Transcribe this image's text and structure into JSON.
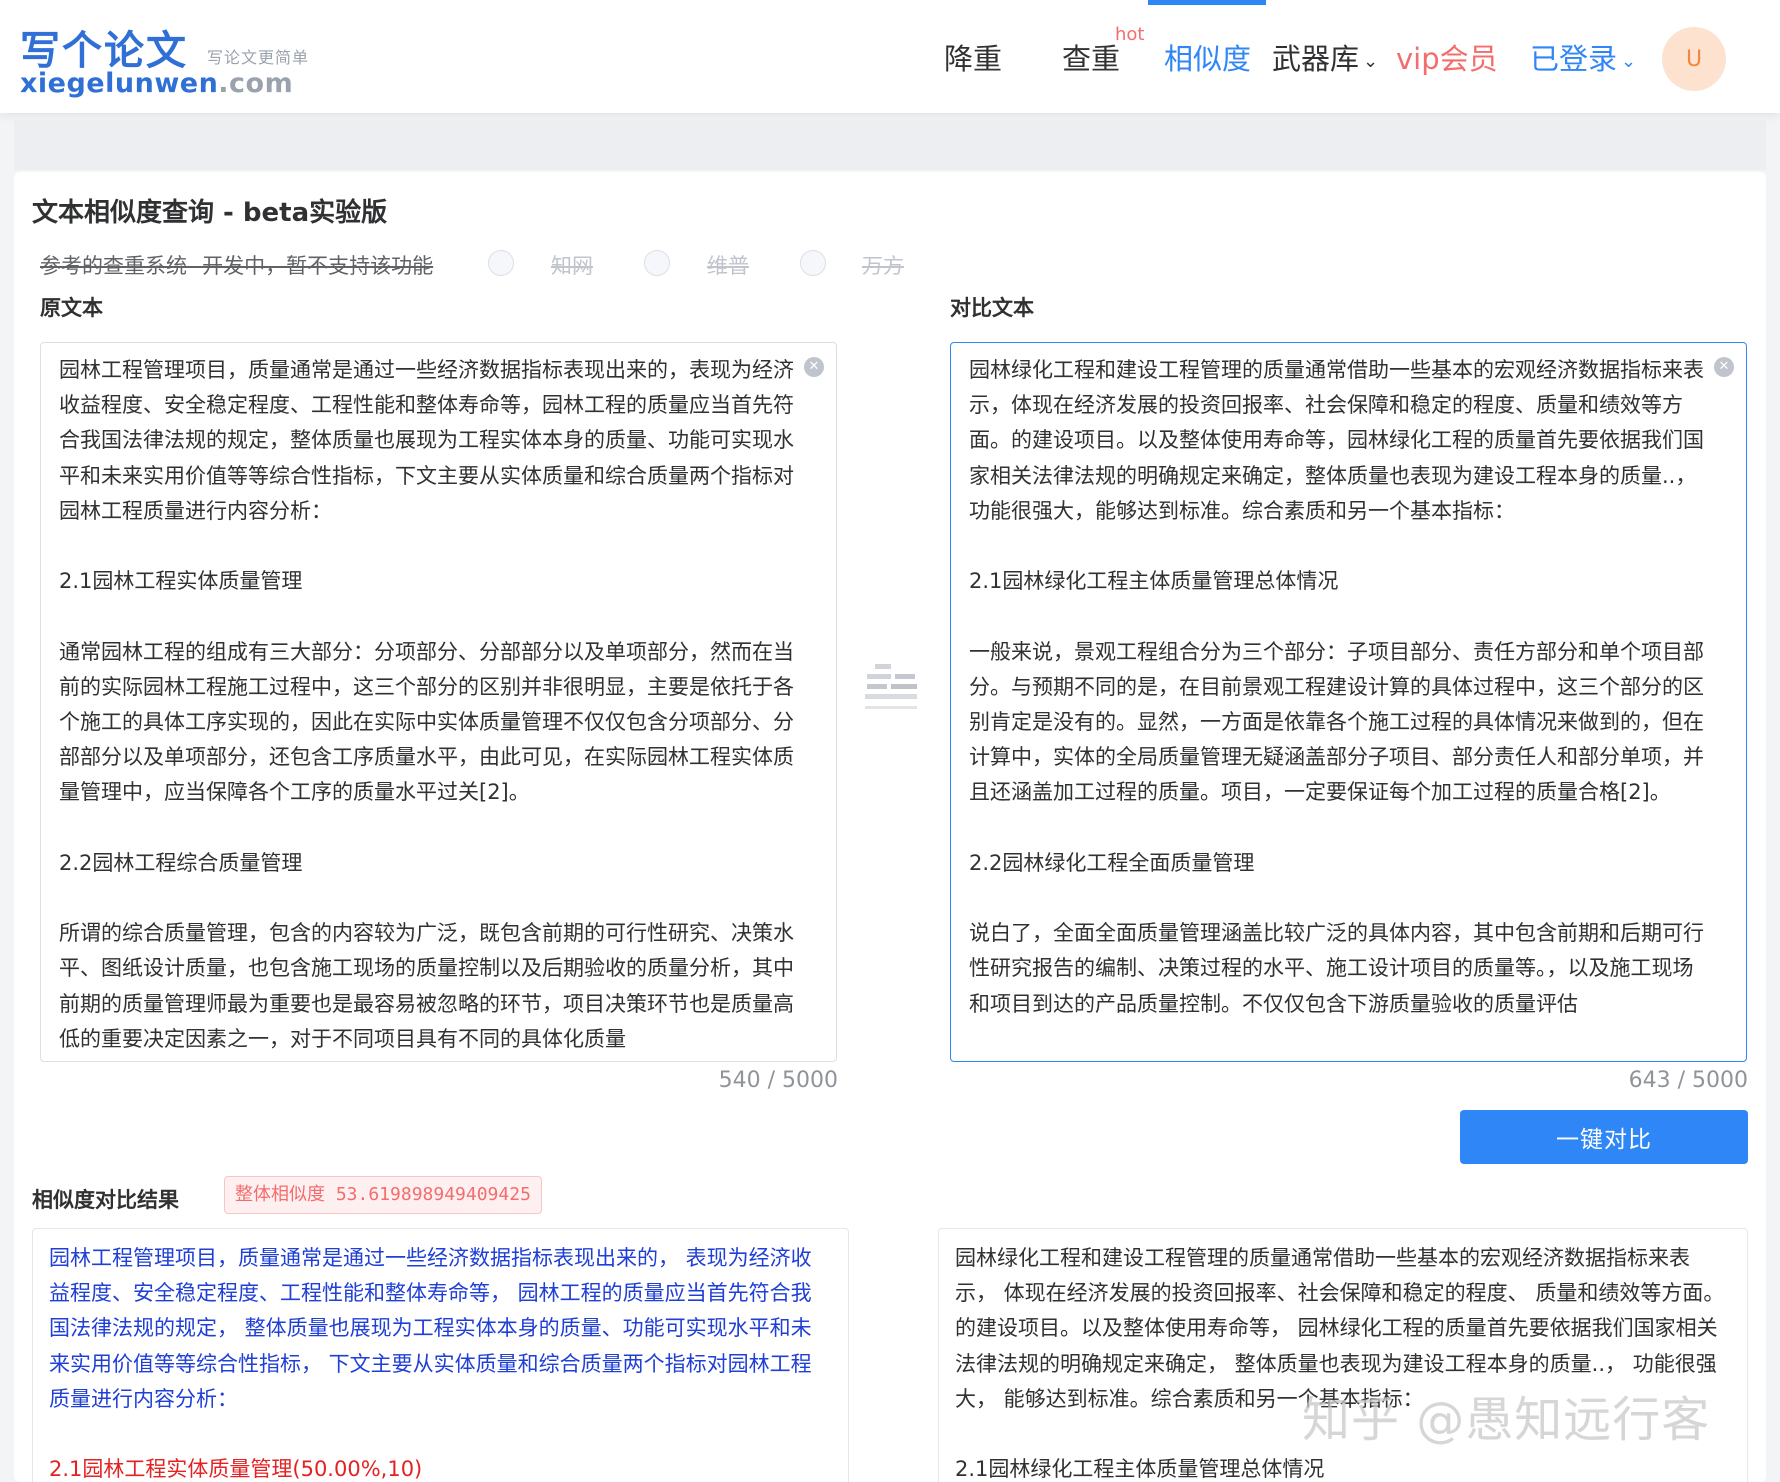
{
  "header": {
    "logo_main": "写个论文",
    "logo_sub": "写论文更简单",
    "logo_url": "xiegelunwen",
    "logo_url_suffix": ".com",
    "nav": {
      "reduce": "降重",
      "check": "查重",
      "hot": "hot",
      "similarity": "相似度",
      "arsenal": "武器库",
      "vip": "vip会员",
      "login": "已登录"
    },
    "avatar_letter": "U",
    "active_tab": "相似度"
  },
  "page": {
    "title": "文本相似度查询 - beta实验版",
    "ref_systems_label": "参考的查重系统--开发中，暂不支持该功能",
    "ref_systems": [
      "知网",
      "维普",
      "万方"
    ]
  },
  "original": {
    "label": "原文本",
    "text": "园林工程管理项目，质量通常是通过一些经济数据指标表现出来的，表现为经济收益程度、安全稳定程度、工程性能和整体寿命等，园林工程的质量应当首先符合我国法律法规的规定，整体质量也展现为工程实体本身的质量、功能可实现水平和未来实用价值等等综合性指标，下文主要从实体质量和综合质量两个指标对园林工程质量进行内容分析：\n\n2.1园林工程实体质量管理\n\n通常园林工程的组成有三大部分：分项部分、分部部分以及单项部分，然而在当前的实际园林工程施工过程中，这三个部分的区别并非很明显，主要是依托于各个施工的具体工序实现的，因此在实际中实体质量管理不仅仅包含分项部分、分部部分以及单项部分，还包含工序质量水平，由此可见，在实际园林工程实体质量管理中，应当保障各个工序的质量水平过关[2]。\n\n2.2园林工程综合质量管理\n\n所谓的综合质量管理，包含的内容较为广泛，既包含前期的可行性研究、决策水平、图纸设计质量，也包含施工现场的质量控制以及后期验收的质量分析，其中前期的质量管理师最为重要也是最容易被忽略的环节，项目决策环节也是质量高低的重要决定因素之一，对于不同项目具有不同的具体化质量",
    "counter": "540 / 5000"
  },
  "compare": {
    "label": "对比文本",
    "text": "园林绿化工程和建设工程管理的质量通常借助一些基本的宏观经济数据指标来表示，体现在经济发展的投资回报率、社会保障和稳定的程度、质量和绩效等方面。的建设项目。以及整体使用寿命等，园林绿化工程的质量首先要依据我们国家相关法律法规的明确规定来确定，整体质量也表现为建设工程本身的质量..，功能很强大，能够达到标准。综合素质和另一个基本指标：\n\n2.1园林绿化工程主体质量管理总体情况\n\n一般来说，景观工程组合分为三个部分：子项目部分、责任方部分和单个项目部分。与预期不同的是，在目前景观工程建设计算的具体过程中，这三个部分的区别肯定是没有的。显然，一方面是依靠各个施工过程的具体情况来做到的，但在计算中，实体的全局质量管理无疑涵盖部分子项目、部分责任人和部分单项，并且还涵盖加工过程的质量。项目，一定要保证每个加工过程的质量合格[2]。\n\n2.2园林绿化工程全面质量管理\n\n说白了，全面全面质量管理涵盖比较广泛的具体内容，其中包含前期和后期可行性研究报告的编制、决策过程的水平、施工设计项目的质量等。，以及施工现场和项目到达的产品质量控制。不仅仅包含下游质量验收的质量评估",
    "counter": "643 / 5000"
  },
  "action": {
    "compare_button": "一键对比"
  },
  "result": {
    "label": "相似度对比结果",
    "similarity_tag": "整体相似度 53.619898949409425",
    "similarity_value": 53.619898949409425,
    "left_blue": "园林工程管理项目，质量通常是通过一些经济数据指标表现出来的， 表现为经济收益程度、安全稳定程度、工程性能和整体寿命等， 园林工程的质量应当首先符合我国法律法规的规定， 整体质量也展现为工程实体本身的质量、功能可实现水平和未来实用价值等等综合性指标， 下文主要从实体质量和综合质量两个指标对园林工程质量进行内容分析：\n\n",
    "left_red": "2.1园林工程实体质量管理(50.00%,10)",
    "right_text": "园林绿化工程和建设工程管理的质量通常借助一些基本的宏观经济数据指标来表示， 体现在经济发展的投资回报率、社会保障和稳定的程度、 质量和绩效等方面。的建设项目。以及整体使用寿命等， 园林绿化工程的质量首先要依据我们国家相关法律法规的明确规定来确定， 整体质量也表现为建设工程本身的质量..， 功能很强大， 能够达到标准。综合素质和另一个基本指标：\n\n2.1园林绿化工程主体质量管理总体情况"
  },
  "watermark": "知乎 @愚知远行客",
  "colors": {
    "accent": "#2f86f6",
    "brand": "#2f6fd6",
    "danger": "#f56c6c",
    "match_blue": "#1f3fd6",
    "match_red": "#e52222"
  }
}
